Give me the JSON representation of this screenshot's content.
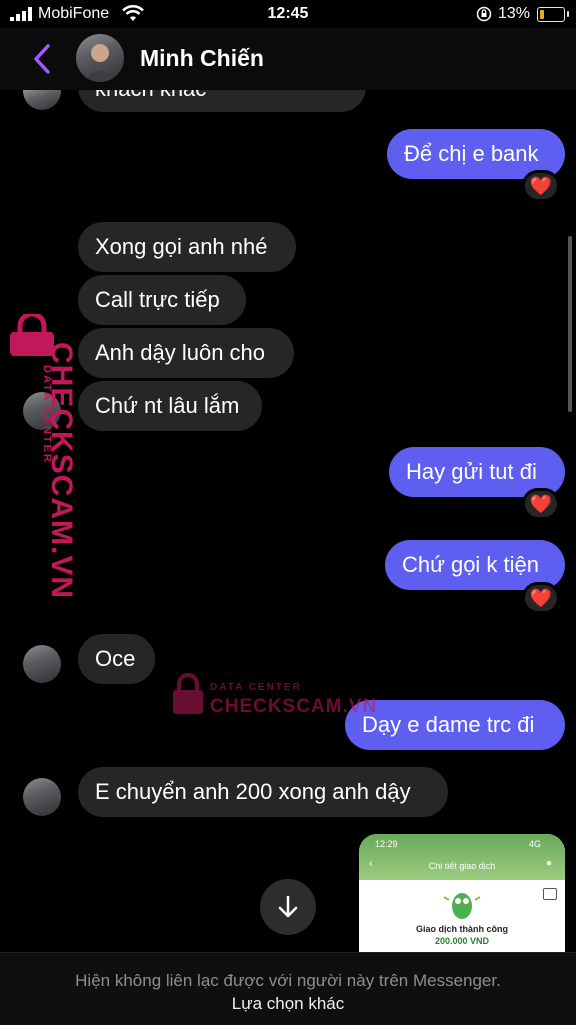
{
  "status_bar": {
    "carrier": "MobiFone",
    "time": "12:45",
    "battery": "13%"
  },
  "header": {
    "contact_name": "Minh Chiến"
  },
  "messages": {
    "m0": "khách khác",
    "m1": "Để chị e bank",
    "m2": "Xong gọi anh nhé",
    "m3": "Call trực tiếp",
    "m4": "Anh dậy luôn cho",
    "m5": "Chứ nt lâu lắm",
    "m6": "Hay gửi tut đi",
    "m7": "Chứ gọi k tiện",
    "m8": "Oce",
    "m9": "Dạy e dame trc đi",
    "m10": "E chuyển anh 200 xong anh dậy"
  },
  "reaction": "❤️",
  "watermark": {
    "line1": "DATA CENTER",
    "line2": "CHECKSCAM.VN"
  },
  "attachment": {
    "time": "12:29",
    "network": "4G",
    "title": "Chi tiết giao dịch",
    "status": "Giao dịch thành công",
    "amount": "200.000 VND"
  },
  "footer": {
    "note": "Hiện không liên lạc được với người này trên Messenger.",
    "alt_link": "Lựa chọn khác"
  },
  "colors": {
    "outgoing": "#5e5ff0",
    "incoming": "#262626",
    "accent": "#a259ff",
    "watermark": "#c2185b"
  }
}
